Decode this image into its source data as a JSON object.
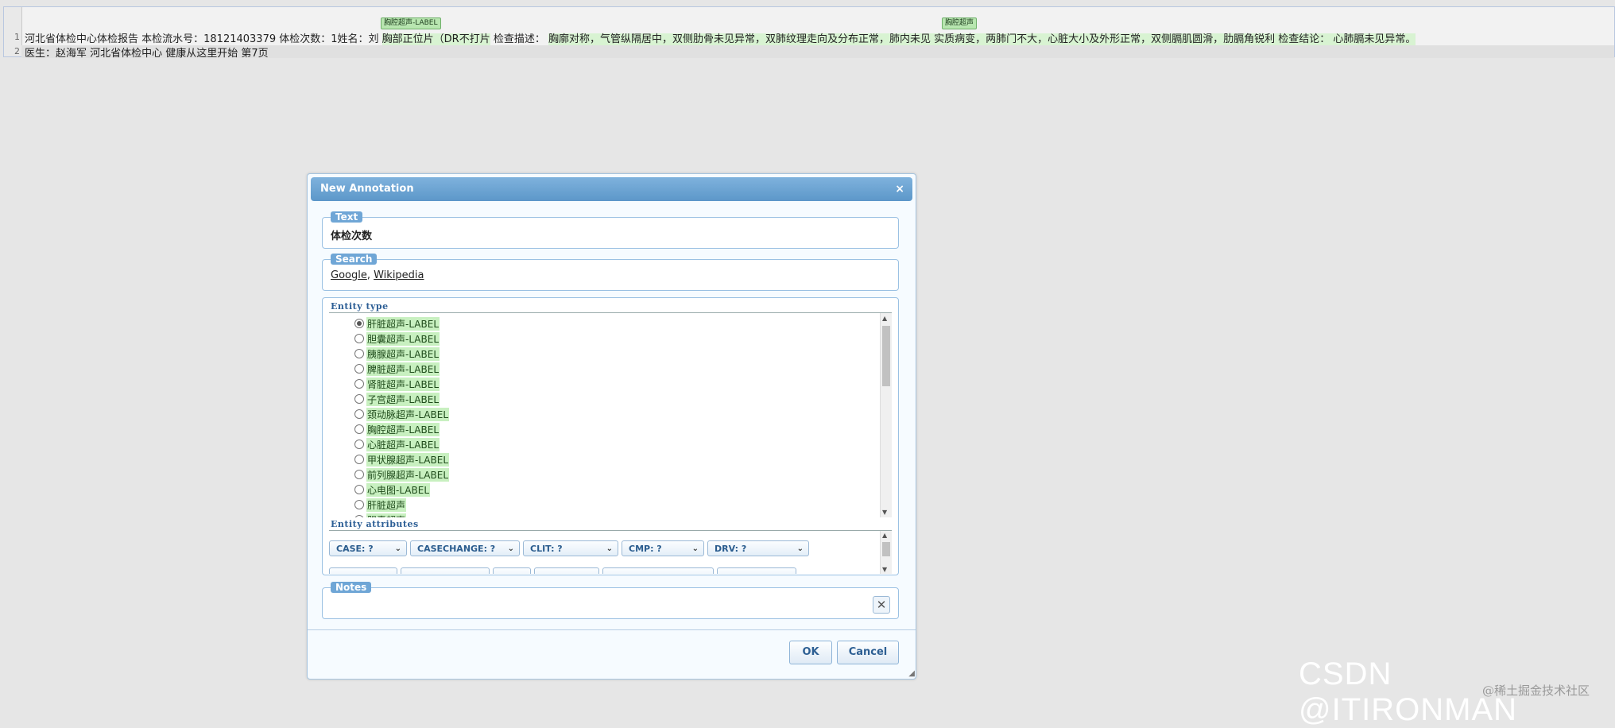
{
  "document": {
    "line1_number": "1",
    "line2_number": "2",
    "line1_text_a": "河北省体检中心体检报告  本检流水号：18121403379  体检次数：1姓名：刘   ",
    "line1_span1": "胸部正位片（DR不打片",
    "line1_text_b": "  检查描述：  ",
    "line1_span2": "胸廓对称，气管纵隔居中，双侧肋骨未见异常，双肺纹理走向及分布正常，肺内未见 实质病变，两肺门不大，心脏大小及外形正常，双侧膈肌圆滑，肋膈角锐利  检查结论：  心肺膈未见异常。",
    "line2_text": "医生：赵海军  河北省体检中心  健康从这里开始  第7页",
    "tag1": "胸腔超声-LABEL",
    "tag2": "胸腔超声"
  },
  "dialog": {
    "title": "New Annotation",
    "close_icon": "×",
    "text_legend": "Text",
    "text_value": "体检次数",
    "search_legend": "Search",
    "search_google": "Google",
    "search_sep": ", ",
    "search_wikipedia": "Wikipedia",
    "entity_type_heading": "Entity type",
    "entity_types": [
      {
        "label": "肝脏超声-LABEL",
        "selected": true
      },
      {
        "label": "胆囊超声-LABEL",
        "selected": false
      },
      {
        "label": "胰腺超声-LABEL",
        "selected": false
      },
      {
        "label": "脾脏超声-LABEL",
        "selected": false
      },
      {
        "label": "肾脏超声-LABEL",
        "selected": false
      },
      {
        "label": "子宫超声-LABEL",
        "selected": false
      },
      {
        "label": "颈动脉超声-LABEL",
        "selected": false
      },
      {
        "label": "胸腔超声-LABEL",
        "selected": false
      },
      {
        "label": "心脏超声-LABEL",
        "selected": false
      },
      {
        "label": "甲状腺超声-LABEL",
        "selected": false
      },
      {
        "label": "前列腺超声-LABEL",
        "selected": false
      },
      {
        "label": "心电图-LABEL",
        "selected": false
      },
      {
        "label": "肝脏超声",
        "selected": false
      },
      {
        "label": "胆囊超声",
        "selected": false
      }
    ],
    "entity_attributes_heading": "Entity attributes",
    "attributes": [
      {
        "label": "CASE: ?"
      },
      {
        "label": "CASECHANGE: ?"
      },
      {
        "label": "CLIT: ?"
      },
      {
        "label": "CMP: ?"
      },
      {
        "label": "DRV: ?"
      }
    ],
    "notes_legend": "Notes",
    "notes_value": "",
    "ok_label": "OK",
    "cancel_label": "Cancel",
    "resize_grip": "◢"
  },
  "watermark": {
    "main": "CSDN @ITIRONMAN",
    "sub": "@稀土掘金技术社区"
  }
}
